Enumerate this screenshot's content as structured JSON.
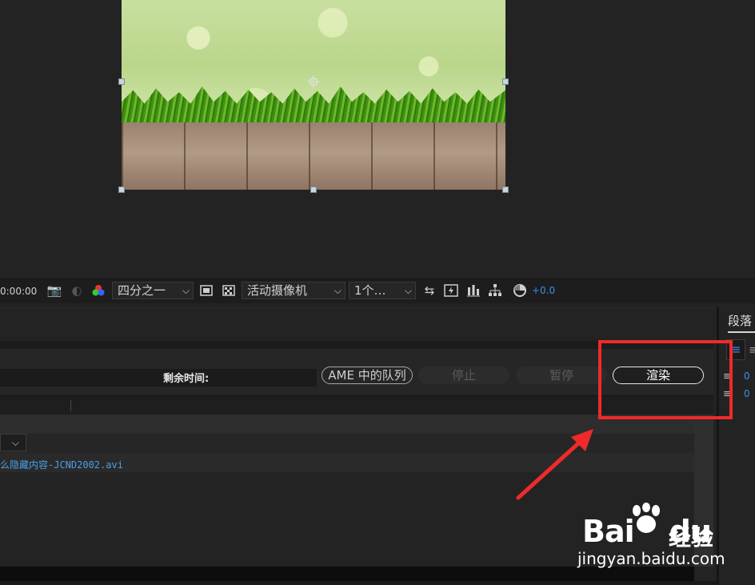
{
  "viewer_toolbar": {
    "timecode": "0:00:00",
    "resolution": "四分之一",
    "camera": "活动摄像机",
    "views": "1个…",
    "exposure": "+0.0",
    "icons": [
      "camera-snapshot-icon",
      "show-snapshot-icon",
      "color-channel-icon",
      "region-of-interest-icon",
      "transparency-grid-icon",
      "view-transfer-icon",
      "fast-preview-icon",
      "timeline-icon",
      "flowchart-icon",
      "exposure-reset-icon"
    ]
  },
  "render_queue": {
    "remaining_label": "剩余时间:",
    "ame_queue_label": "AME 中的队列",
    "stop_label": "停止",
    "pause_label": "暂停",
    "render_label": "渲染",
    "output_file": "么隐藏内容-JCND2002.avi"
  },
  "paragraph_panel": {
    "tab_label": "段落",
    "indent_values": [
      "0",
      "0"
    ]
  },
  "watermark": {
    "logo": "Bai",
    "logo_suffix": "du",
    "brand": "经验",
    "url": "jingyan.baidu.com"
  },
  "colors": {
    "highlight": "#f02a2a",
    "link": "#4aa0e8",
    "accent": "#3a8ee6"
  }
}
